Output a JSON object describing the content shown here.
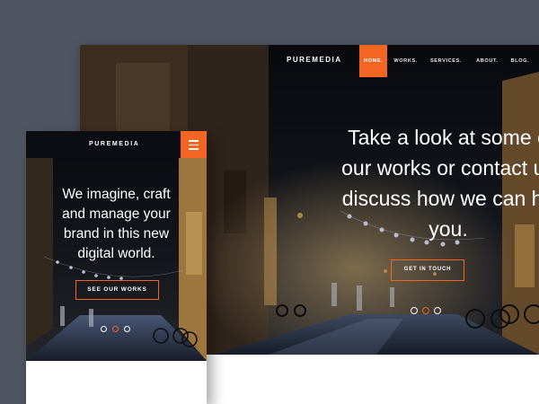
{
  "desktop": {
    "logo": "PUREMEDIA",
    "nav": [
      {
        "label": "HOME.",
        "active": true
      },
      {
        "label": "WORKS.",
        "active": false
      },
      {
        "label": "SERVICES.",
        "active": false
      },
      {
        "label": "ABOUT.",
        "active": false
      },
      {
        "label": "BLOG.",
        "active": false
      },
      {
        "label": "CO",
        "active": false
      }
    ],
    "headline_lines": [
      "Take a look at some o",
      "our works or contact us",
      "discuss how we can he",
      "you."
    ],
    "cta": "GET IN TOUCH",
    "slider": {
      "count": 3,
      "active_index": 1
    }
  },
  "mobile": {
    "logo": "PUREMEDIA",
    "headline_lines": [
      "We imagine, craft",
      "and manage your",
      "brand in this new",
      "digital world."
    ],
    "cta": "SEE OUR WORKS",
    "slider": {
      "count": 3,
      "active_index": 1
    }
  },
  "colors": {
    "accent": "#f26522",
    "background": "#4f5661"
  },
  "icons": {
    "menu": "hamburger-menu-icon"
  }
}
